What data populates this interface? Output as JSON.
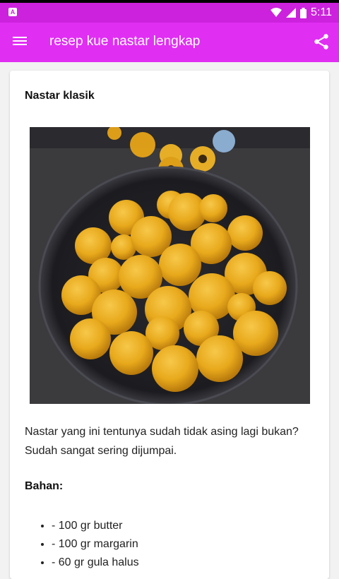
{
  "status_bar": {
    "notification_icon": "android-a-icon",
    "time": "5:11",
    "icons": [
      "wifi-icon",
      "signal-icon",
      "battery-icon"
    ]
  },
  "app_bar": {
    "title": "resep kue nastar lengkap",
    "menu_icon": "hamburger-menu-icon",
    "share_icon": "share-icon",
    "color": "#e02ef3"
  },
  "article": {
    "title": "Nastar klasik",
    "image_alt": "nastar-cookies-photo",
    "description": "Nastar yang ini tentunya sudah tidak asing lagi bukan? Sudah sangat sering dijumpai.",
    "bahan_title": "Bahan:",
    "ingredients": [
      "- 100 gr butter",
      "- 100 gr margarin",
      "- 60 gr gula halus"
    ]
  }
}
